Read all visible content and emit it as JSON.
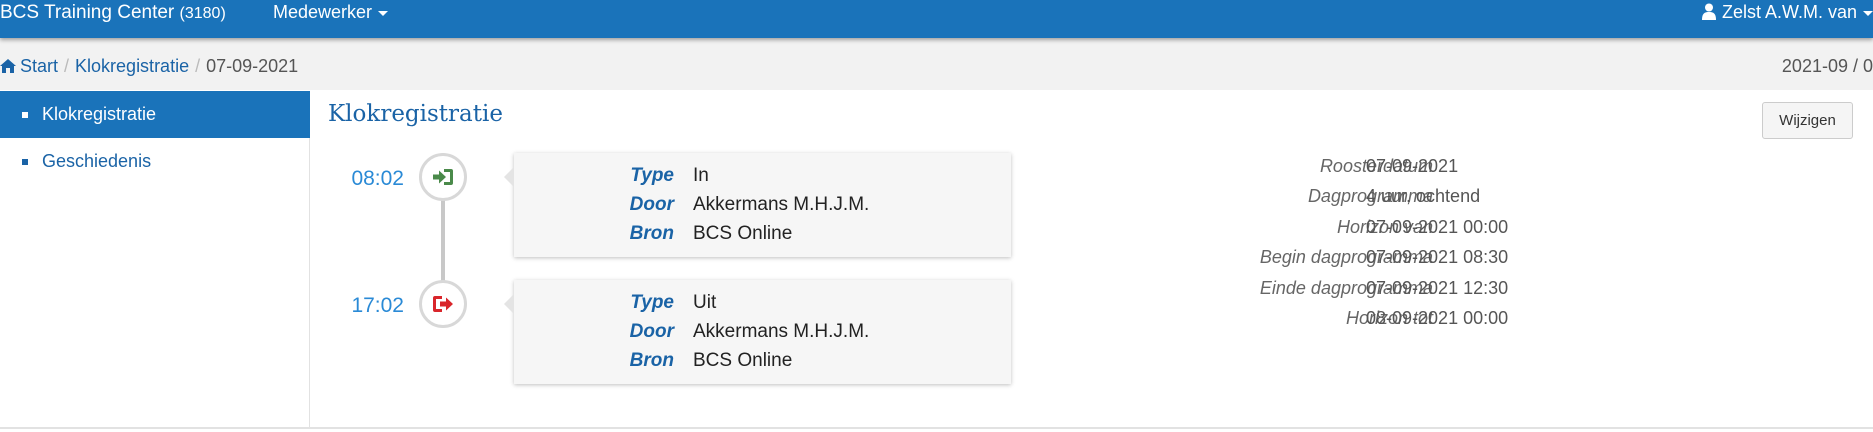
{
  "navbar": {
    "brand": "BCS Training Center",
    "brand_code": "(3180)",
    "menu_label": "Medewerker",
    "user_label": "Zelst A.W.M. van"
  },
  "breadcrumb": {
    "home": "Start",
    "section": "Klokregistratie",
    "current": "07-09-2021",
    "right_text": "2021-09 / 0"
  },
  "sidebar": {
    "items": [
      {
        "label": "Klokregistratie",
        "active": true
      },
      {
        "label": "Geschiedenis",
        "active": false
      }
    ]
  },
  "main": {
    "title": "Klokregistratie",
    "edit_button": "Wijzigen"
  },
  "timeline": [
    {
      "time": "08:02",
      "icon": "sign-in-icon",
      "icon_color": "#4a8a4a",
      "fields": [
        {
          "key": "Type",
          "value": "In"
        },
        {
          "key": "Door",
          "value": "Akkermans M.H.J.M."
        },
        {
          "key": "Bron",
          "value": "BCS Online"
        }
      ]
    },
    {
      "time": "17:02",
      "icon": "sign-out-icon",
      "icon_color": "#d9262b",
      "fields": [
        {
          "key": "Type",
          "value": "Uit"
        },
        {
          "key": "Door",
          "value": "Akkermans M.H.J.M."
        },
        {
          "key": "Bron",
          "value": "BCS Online"
        }
      ]
    }
  ],
  "details": [
    {
      "label": "Roosterdatum",
      "value": "07-09-2021"
    },
    {
      "label": "Dagprogramma",
      "value": "4 uur, ochtend"
    },
    {
      "label": "Horizon van",
      "value": "07-09-2021 00:00"
    },
    {
      "label": "Begin dagprogramma",
      "value": "07-09-2021 08:30"
    },
    {
      "label": "Einde dagprogramma",
      "value": "07-09-2021 12:30"
    },
    {
      "label": "Horizon tot",
      "value": "08-09-2021 00:00"
    }
  ],
  "colors": {
    "navbar": "#1a73ba",
    "link": "#1a63a6",
    "time": "#2a8ad6"
  }
}
